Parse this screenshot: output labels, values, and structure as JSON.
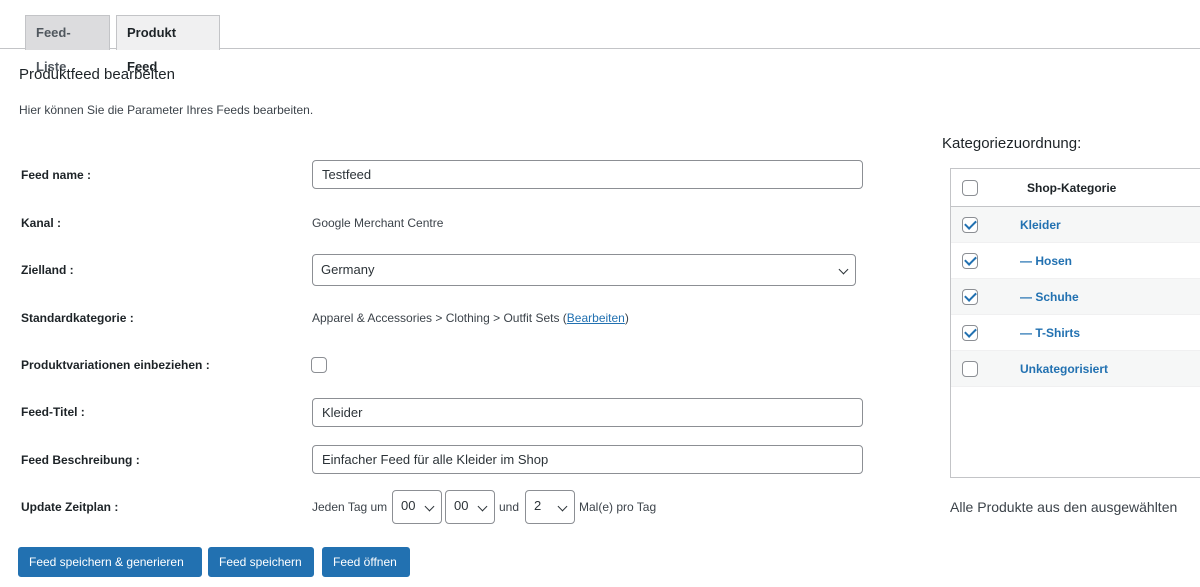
{
  "tabs": [
    {
      "label": "Feed-Liste",
      "active": false
    },
    {
      "label": "Produkt Feed",
      "active": true
    }
  ],
  "page": {
    "title": "Produktfeed bearbeiten",
    "description": "Hier können Sie die Parameter Ihres Feeds bearbeiten."
  },
  "form": {
    "feed_name": {
      "label": "Feed name :",
      "value": "Testfeed"
    },
    "kanal": {
      "label": "Kanal :",
      "value": "Google Merchant Centre"
    },
    "zielland": {
      "label": "Zielland :",
      "value": "Germany"
    },
    "standardkategorie": {
      "label": "Standardkategorie :",
      "value": "Apparel & Accessories > Clothing > Outfit Sets (",
      "link": "Bearbeiten",
      "suffix": ")"
    },
    "produktvariationen": {
      "label": "Produktvariationen einbeziehen :",
      "checked": false
    },
    "feed_titel": {
      "label": "Feed-Titel :",
      "value": "Kleider"
    },
    "feed_beschreibung": {
      "label": "Feed Beschreibung :",
      "value": "Einfacher Feed für alle Kleider im Shop"
    },
    "update_zeitplan": {
      "label": "Update Zeitplan :",
      "prefix": "Jeden Tag um",
      "hour": "00",
      "minute": "00",
      "und": "und",
      "count": "2",
      "suffix": "Mal(e) pro Tag"
    }
  },
  "buttons": {
    "save_generate": "Feed speichern & generieren",
    "save": "Feed speichern",
    "open": "Feed öffnen"
  },
  "categories": {
    "title": "Kategoriezuordnung:",
    "header": "Shop-Kategorie",
    "items": [
      {
        "label": "Kleider",
        "checked": true
      },
      {
        "label": "— Hosen",
        "checked": true
      },
      {
        "label": "— Schuhe",
        "checked": true
      },
      {
        "label": "— T-Shirts",
        "checked": true
      },
      {
        "label": "Unkategorisiert",
        "checked": false
      }
    ],
    "note": "Alle Produkte aus den ausgewählten"
  },
  "colors": {
    "accent": "#2271b1",
    "border": "#8c8f94"
  }
}
